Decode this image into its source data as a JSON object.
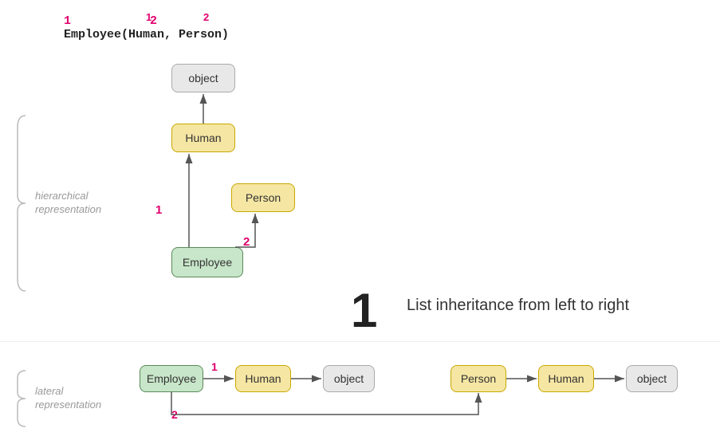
{
  "code": {
    "num1": "1",
    "num2": "2",
    "text": "Employee",
    "args": "(Human, Person)"
  },
  "hierarchical": {
    "label_line1": "hierarchical",
    "label_line2": "representation",
    "nodes": {
      "object": "object",
      "human": "Human",
      "person": "Person",
      "employee": "Employee"
    },
    "num1": "1",
    "num2": "2"
  },
  "big_number": "1",
  "big_label": "List inheritance from left to right",
  "lateral": {
    "label_line1": "lateral",
    "label_line2": "representation",
    "num1": "1",
    "num2": "2",
    "nodes": {
      "employee": "Employee",
      "human1": "Human",
      "object1": "object",
      "person": "Person",
      "human2": "Human",
      "object2": "object"
    }
  }
}
